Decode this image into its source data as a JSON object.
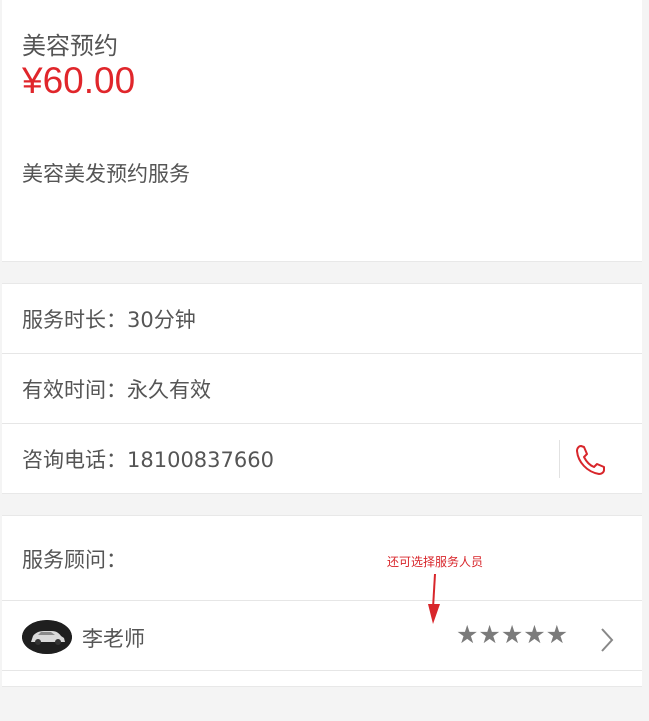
{
  "service": {
    "title": "美容预约",
    "price": "¥60.00",
    "description": "美容美发预约服务"
  },
  "info": {
    "duration": "服务时长：30分钟",
    "validity": "有效时间：永久有效",
    "phone": "咨询电话：18100837660",
    "phone_icon": "phone-icon"
  },
  "advisor": {
    "heading": "服务顾问：",
    "annotation": "还可选择服务人员",
    "name": "李老师",
    "rating_stars": "★★★★★",
    "rating": 5,
    "rating_max": 5,
    "avatar_icon": "car-avatar",
    "chevron_icon": "chevron-right-icon"
  },
  "colors": {
    "price": "#e0262b",
    "phone_icon": "#d8262b",
    "annotation": "#d8262b",
    "stars": "#7b7b7b"
  }
}
